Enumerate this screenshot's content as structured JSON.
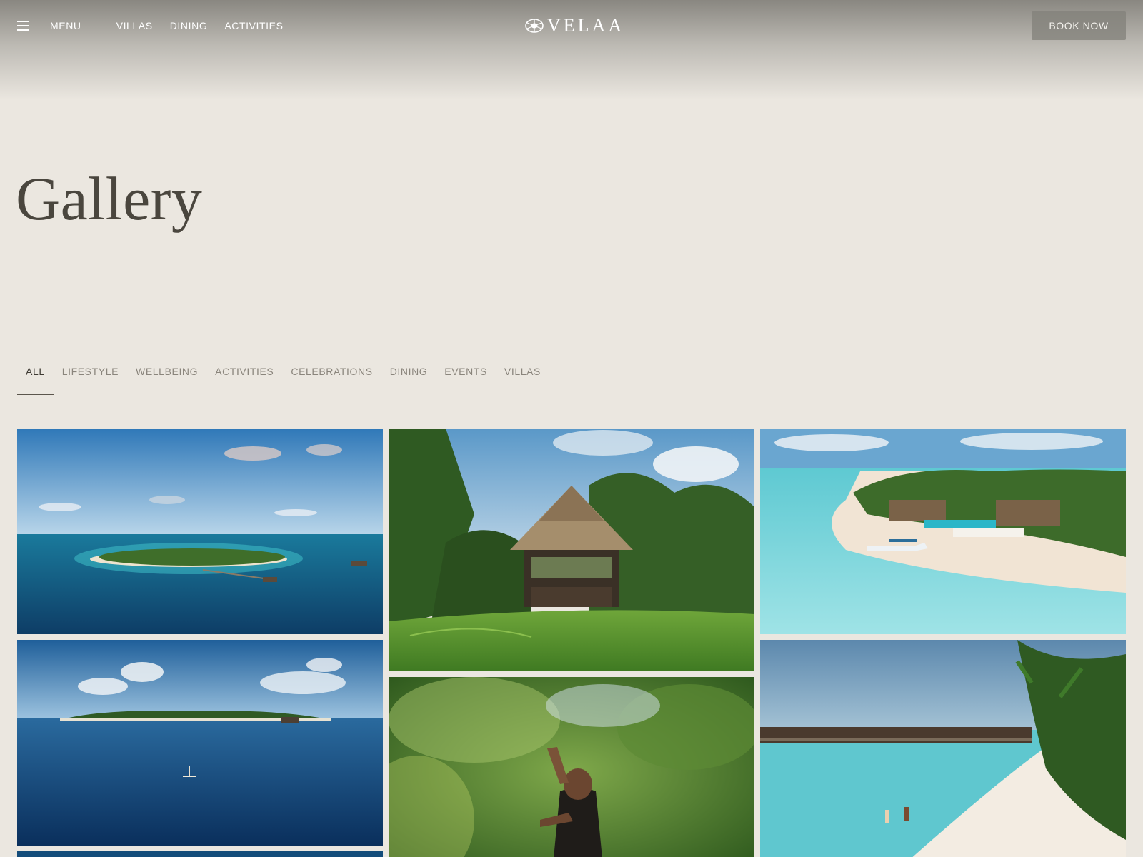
{
  "header": {
    "menu_label": "MENU",
    "nav_links": [
      "VILLAS",
      "DINING",
      "ACTIVITIES"
    ],
    "logo_text": "VELAA",
    "book_label": "BOOK NOW"
  },
  "page": {
    "title": "Gallery"
  },
  "filters": {
    "tabs": [
      "ALL",
      "LIFESTYLE",
      "WELLBEING",
      "ACTIVITIES",
      "CELEBRATIONS",
      "DINING",
      "EVENTS",
      "VILLAS"
    ],
    "active": "ALL"
  },
  "colors": {
    "background": "#ebe7e0",
    "text": "#4a463e",
    "muted": "#8a857c",
    "ocean": "#1f7fa0",
    "lagoon": "#54c6cf",
    "sand": "#f1e6d8",
    "foliage": "#3e6b2a"
  },
  "gallery": {
    "images": [
      {
        "name": "island-aerial-image"
      },
      {
        "name": "thatched-pavilion-golf-image"
      },
      {
        "name": "beach-seaplane-aerial-image"
      },
      {
        "name": "island-paddleboard-image"
      },
      {
        "name": "yoga-palms-image"
      },
      {
        "name": "beach-couple-water-villas-image"
      }
    ]
  }
}
